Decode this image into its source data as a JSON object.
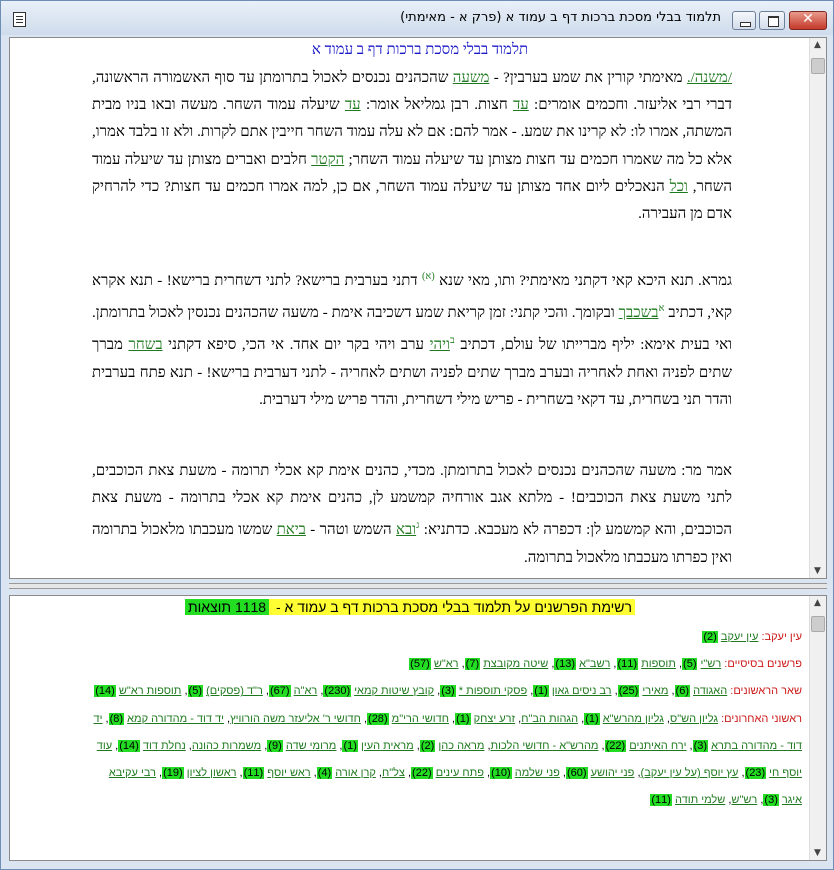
{
  "window": {
    "title": "תלמוד בבלי מסכת ברכות דף ב עמוד א (פרק א - מאימתי)",
    "close_label": "✕"
  },
  "text_pane": {
    "title": "תלמוד בבלי מסכת ברכות דף ב עמוד א",
    "para1": {
      "link1": "/משנה/.",
      "t1": " מאימתי קורין את שמע בערבין? - ",
      "link2": "משעה",
      "t2": " שהכהנים נכנסים לאכול בתרומתן עד סוף האשמורה הראשונה, דברי רבי אליעזר. וחכמים אומרים: ",
      "link3": "עד",
      "t3": " חצות. רבן גמליאל אומר: ",
      "link4": "עד",
      "t4": " שיעלה עמוד השחר. מעשה ובאו בניו מבית המשתה, אמרו לו: לא קרינו את שמע. - אמר להם: אם לא עלה עמוד השחר חייבין אתם לקרות. ולא זו בלבד אמרו, אלא כל מה שאמרו חכמים עד חצות מצותן עד שיעלה עמוד השחר; ",
      "link5": "הקטר",
      "t5": " חלבים ואברים מצותן עד שיעלה עמוד השחר, ",
      "link6": "וכל",
      "t6": " הנאכלים ליום אחד מצותן עד שיעלה עמוד השחר, אם כן, למה אמרו חכמים עד חצות? כדי להרחיק אדם מן העבירה."
    },
    "para2": {
      "t1": "גמרא. תנא היכא קאי דקתני מאימתי? ותו, מאי שנא ",
      "fn1": "(א)",
      "t2": " דתני בערבית ברישא? לתני דשחרית ברישא! - תנא אקרא קאי, דכתיב ",
      "fn2": "א",
      "link1": "בשכבך",
      "t3": " ובקומך. והכי קתני: זמן קריאת שמע דשכיבה אימת - משעה שהכהנים נכנסין לאכול בתרומתן. ואי בעית אימא: יליף מברייתו של עולם, דכתיב ",
      "fn3": "ב",
      "link2": "ויהי",
      "t4": " ערב ויהי בקר יום אחד. אי הכי, סיפא דקתני ",
      "link3": "בשחר",
      "t5": " מברך שתים לפניה ואחת לאחריה ובערב מברך שתים לפניה ושתים לאחריה - לתני דערבית ברישא! - תנא פתח בערבית והדר תני בשחרית, עד דקאי בשחרית - פריש מילי דשחרית, והדר פריש מילי דערבית."
    },
    "para3": {
      "t1": "אמר מר: משעה שהכהנים נכנסים לאכול בתרומתן. מכדי, כהנים אימת קא אכלי תרומה - משעת צאת הכוכבים, לתני משעת צאת הכוכבים! - מלתא אגב אורחיה קמשמע לן, כהנים אימת קא אכלי בתרומה - משעת צאת הכוכבים, והא קמשמע לן: דכפרה לא מעכבא. כדתניא: ",
      "fn1": "ג",
      "link1": "ובא",
      "t2": " השמש וטהר - ",
      "link2": "ביאת",
      "t3": " שמשו מעכבתו מלאכול בתרומה ואין כפרתו מעכבתו מלאכול בתרומה."
    }
  },
  "list_pane": {
    "title_main": "רשימת הפרשנים על תלמוד בבלי מסכת ברכות דף ב עמוד א - ",
    "title_count": "1118 תוצאות",
    "categories": [
      {
        "label": "עין יעקב:",
        "items": [
          {
            "name": "עין יעקב",
            "count": "2"
          }
        ]
      },
      {
        "label": "פרשנים בסיסיים:",
        "items": [
          {
            "name": "רש\"י",
            "count": "5"
          },
          {
            "name": "תוספות",
            "count": "11"
          },
          {
            "name": "רשב\"א",
            "count": "13"
          },
          {
            "name": "שיטה מקובצת",
            "count": "7"
          },
          {
            "name": "רא\"ש",
            "count": "57"
          }
        ]
      },
      {
        "label": "שאר הראשונים:",
        "items": [
          {
            "name": "האגודה",
            "count": "6"
          },
          {
            "name": "מאירי",
            "count": "25"
          },
          {
            "name": "רב ניסים גאון",
            "count": "1"
          },
          {
            "name": "פסקי תוספות *",
            "count": "3"
          },
          {
            "name": "קובץ שיטות קמאי",
            "count": "230"
          },
          {
            "name": "רא\"ה",
            "count": "67"
          },
          {
            "name": "ר\"ד (פסקים)",
            "count": "5"
          },
          {
            "name": "תוספות רא\"ש",
            "count": "14"
          }
        ]
      },
      {
        "label": "ראשוני האחרונים:",
        "items": [
          {
            "name": "גליון הש\"ס",
            "count": ""
          },
          {
            "name": "גליון מהרש\"א",
            "count": "1"
          },
          {
            "name": "הגהות הב\"ח",
            "count": ""
          },
          {
            "name": "זרע יצחק",
            "count": "1"
          },
          {
            "name": "חדושי הרי\"מ",
            "count": "28"
          },
          {
            "name": "חדושי ר' אליעזר משה הורוויץ",
            "count": ""
          },
          {
            "name": "יד דוד - מהדורה קמא",
            "count": "8"
          },
          {
            "name": "יד דוד - מהדורה בתרא",
            "count": "3"
          },
          {
            "name": "ירח האיתנים",
            "count": "22"
          },
          {
            "name": "מהרש\"א - חדושי הלכות",
            "count": ""
          },
          {
            "name": "מראה כהן",
            "count": "2"
          },
          {
            "name": "מראית העין",
            "count": "1"
          },
          {
            "name": "מרומי שדה",
            "count": "9"
          },
          {
            "name": "משמרות כהונה",
            "count": ""
          },
          {
            "name": "נחלת דוד",
            "count": "14"
          },
          {
            "name": "עוד יוסף חי",
            "count": "23"
          },
          {
            "name": "עץ יוסף (על עין יעקב)",
            "count": ""
          },
          {
            "name": "פני יהושע",
            "count": "60"
          },
          {
            "name": "פני שלמה",
            "count": "10"
          },
          {
            "name": "פתח עינים",
            "count": "22"
          },
          {
            "name": "צל\"ח",
            "count": ""
          },
          {
            "name": "קרן אורה",
            "count": "4"
          },
          {
            "name": "ראש יוסף",
            "count": "11"
          },
          {
            "name": "ראשון לציון",
            "count": "19"
          },
          {
            "name": "רבי עקיבא איגר",
            "count": "3"
          },
          {
            "name": "רש\"ש",
            "count": ""
          },
          {
            "name": "שלמי תודה",
            "count": "11"
          }
        ]
      }
    ]
  }
}
